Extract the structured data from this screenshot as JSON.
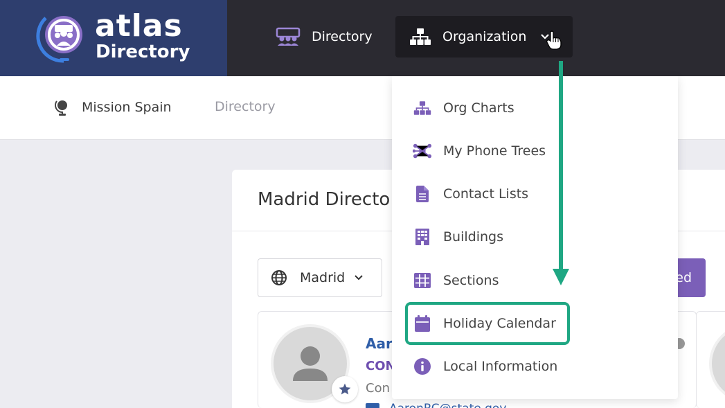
{
  "brand": {
    "name": "atlas",
    "subtitle": "Directory"
  },
  "nav": {
    "directory_label": "Directory",
    "organization_label": "Organization"
  },
  "subheader": {
    "mission_label": "Mission Spain",
    "breadcrumb_directory": "Directory"
  },
  "card": {
    "title": "Madrid Directo",
    "city_select_value": "Madrid",
    "action_button_label": "ed"
  },
  "person": {
    "name": "Aar",
    "role": "CON",
    "sub": "Con",
    "email": "AaronRC@state.gov"
  },
  "dropdown": {
    "items": [
      {
        "label": "Org Charts",
        "icon": "org-chart-icon"
      },
      {
        "label": "My Phone Trees",
        "icon": "phone-tree-icon"
      },
      {
        "label": "Contact Lists",
        "icon": "document-icon"
      },
      {
        "label": "Buildings",
        "icon": "building-icon"
      },
      {
        "label": "Sections",
        "icon": "grid-icon"
      },
      {
        "label": "Holiday Calendar",
        "icon": "calendar-icon"
      },
      {
        "label": "Local Information",
        "icon": "info-icon"
      }
    ]
  },
  "colors": {
    "menu_icon": "#7b5fb8",
    "highlight": "#1fa783",
    "header_bg": "#2b2a31",
    "brand_bg": "#2e3e6e"
  }
}
